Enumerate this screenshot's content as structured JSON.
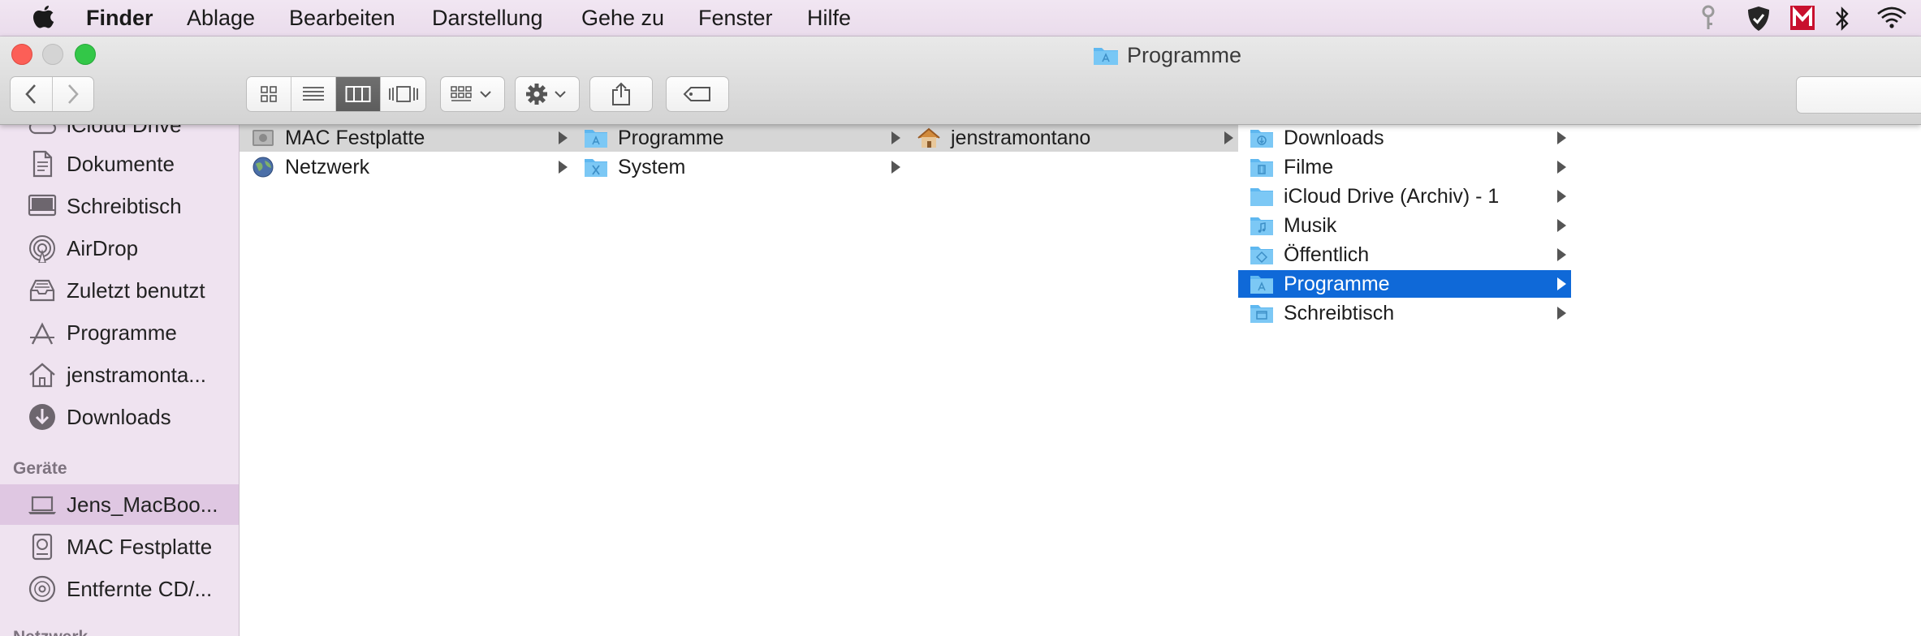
{
  "menubar": {
    "app_name": "Finder",
    "items": [
      "Ablage",
      "Bearbeiten",
      "Darstellung",
      "Gehe zu",
      "Fenster",
      "Hilfe"
    ]
  },
  "window": {
    "title": "Programme"
  },
  "sidebar": {
    "favorites": [
      {
        "label": "iCloud Drive",
        "icon": "cloud-icon"
      },
      {
        "label": "Dokumente",
        "icon": "document-icon"
      },
      {
        "label": "Schreibtisch",
        "icon": "desktop-icon"
      },
      {
        "label": "AirDrop",
        "icon": "airdrop-icon"
      },
      {
        "label": "Zuletzt benutzt",
        "icon": "recents-icon"
      },
      {
        "label": "Programme",
        "icon": "apps-icon"
      },
      {
        "label": "jenstramonta...",
        "icon": "home-icon"
      },
      {
        "label": "Downloads",
        "icon": "download-icon"
      }
    ],
    "devices_heading": "Geräte",
    "devices": [
      {
        "label": "Jens_MacBoo...",
        "icon": "laptop-icon",
        "selected": true
      },
      {
        "label": "MAC Festplatte",
        "icon": "harddisk-icon"
      },
      {
        "label": "Entfernte CD/...",
        "icon": "disc-icon"
      }
    ],
    "network_heading": "Netzwerk"
  },
  "columns": [
    {
      "items": [
        {
          "label": "MAC Festplatte",
          "icon": "harddisk-icon",
          "state": "path"
        },
        {
          "label": "Netzwerk",
          "icon": "globe-icon",
          "state": "none"
        }
      ]
    },
    {
      "items": [
        {
          "label": "Programme",
          "icon": "apps-folder-icon",
          "state": "path"
        },
        {
          "label": "System",
          "icon": "system-folder-icon",
          "state": "none"
        }
      ]
    },
    {
      "items": [
        {
          "label": "jenstramontano",
          "icon": "home-icon",
          "state": "path"
        }
      ]
    },
    {
      "items": [
        {
          "label": "Downloads",
          "icon": "downloads-folder-icon",
          "state": "none"
        },
        {
          "label": "Filme",
          "icon": "movies-folder-icon",
          "state": "none"
        },
        {
          "label": "iCloud Drive (Archiv) - 1",
          "icon": "folder-icon",
          "state": "none"
        },
        {
          "label": "Musik",
          "icon": "music-folder-icon",
          "state": "none"
        },
        {
          "label": "Öffentlich",
          "icon": "public-folder-icon",
          "state": "none"
        },
        {
          "label": "Programme",
          "icon": "apps-folder-icon",
          "state": "selected"
        },
        {
          "label": "Schreibtisch",
          "icon": "desktop-folder-icon",
          "state": "none"
        }
      ]
    }
  ],
  "colors": {
    "selection_blue": "#0f69d8",
    "sidebar_bg": "#efe3f0",
    "folder_blue": "#5fb8f0"
  }
}
